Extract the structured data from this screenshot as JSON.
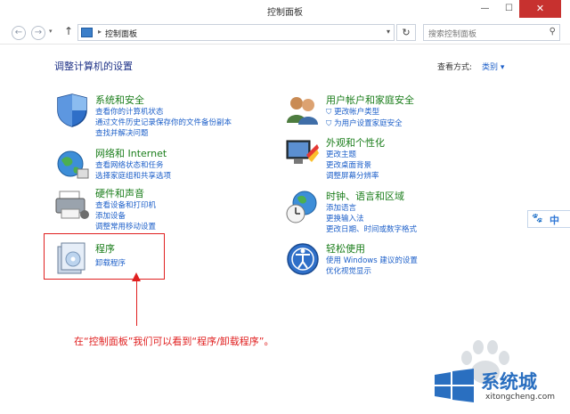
{
  "window": {
    "title": "控制面板",
    "minimize": "—",
    "maximize": "☐",
    "close": "✕"
  },
  "nav": {
    "back": "←",
    "forward": "→",
    "up": "↑",
    "breadcrumb": "控制面板",
    "refresh": "↻",
    "search_placeholder": "搜索控制面板"
  },
  "main": {
    "heading": "调整计算机的设置",
    "view_by_label": "查看方式:",
    "view_by_value": "类别 ▾"
  },
  "categories": [
    {
      "name": "系统和安全",
      "icon": "shield-icon",
      "links": [
        "查看你的计算机状态",
        "通过文件历史记录保存你的文件备份副本",
        "查找并解决问题"
      ]
    },
    {
      "name": "网络和 Internet",
      "icon": "network-globe-icon",
      "links": [
        "查看网络状态和任务",
        "选择家庭组和共享选项"
      ]
    },
    {
      "name": "硬件和声音",
      "icon": "printer-icon",
      "links": [
        "查看设备和打印机",
        "添加设备",
        "调整常用移动设置"
      ]
    },
    {
      "name": "程序",
      "icon": "programs-box-icon",
      "links": [
        "卸载程序"
      ]
    },
    {
      "name": "用户帐户和家庭安全",
      "icon": "users-icon",
      "links": [
        "更改帐户类型",
        "为用户设置家庭安全"
      ]
    },
    {
      "name": "外观和个性化",
      "icon": "display-palette-icon",
      "links": [
        "更改主题",
        "更改桌面背景",
        "调整屏幕分辨率"
      ]
    },
    {
      "name": "时钟、语言和区域",
      "icon": "clock-globe-icon",
      "links": [
        "添加语言",
        "更换输入法",
        "更改日期、时间或数字格式"
      ]
    },
    {
      "name": "轻松使用",
      "icon": "ease-of-access-icon",
      "links": [
        "使用 Windows 建议的设置",
        "优化视觉显示"
      ]
    }
  ],
  "annotation": "在“控制面板”我们可以看到“程序/卸载程序”。",
  "ime": {
    "label": "中"
  },
  "watermark": {
    "brand": "系统城",
    "url": "xitongcheng.com"
  },
  "colors": {
    "category_title": "#1a7d1a",
    "link": "#1c5fc9",
    "annotation": "#e02020",
    "close_button": "#c7312f"
  }
}
